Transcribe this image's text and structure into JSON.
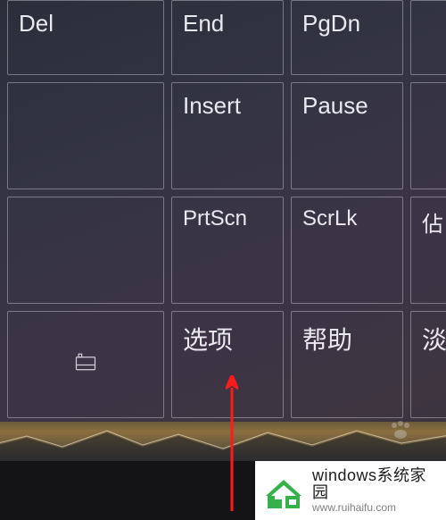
{
  "keyboard": {
    "row1": {
      "del": "Del",
      "end": "End",
      "pgdn": "PgDn"
    },
    "row2": {
      "insert": "Insert",
      "pause": "Pause"
    },
    "row3": {
      "prtscn": "PrtScn",
      "scrlk": "ScrLk",
      "cut3": "佔"
    },
    "row4": {
      "dock_icon": "dock-icon",
      "options": "选项",
      "help": "帮助",
      "cut4": "淡"
    }
  },
  "pointer": {
    "target": "options-key",
    "color": "#ff1a1a"
  },
  "watermark": {
    "title": "windows系统家园",
    "url": "www.ruihaifu.com",
    "brand_color": "#35b04a"
  },
  "paw_glyph": "⠶"
}
